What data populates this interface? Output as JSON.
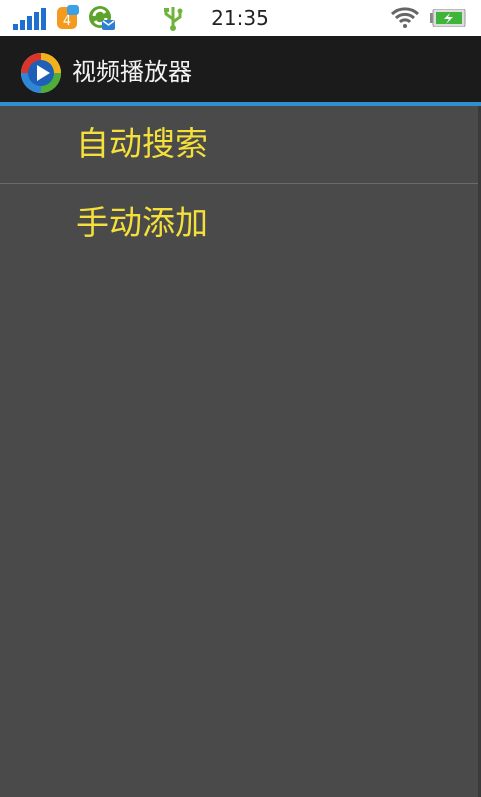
{
  "status_bar": {
    "time": "21:35",
    "badge_count": "4",
    "icons": [
      "signal-icon",
      "notification-badge-icon",
      "sync-mail-icon",
      "usb-icon",
      "wifi-icon",
      "battery-charging-icon"
    ]
  },
  "app_bar": {
    "title": "视频播放器",
    "icon": "video-player-icon"
  },
  "menu": {
    "items": [
      {
        "label": "自动搜索"
      },
      {
        "label": "手动添加"
      }
    ]
  },
  "colors": {
    "background": "#4a4a4a",
    "app_bar": "#1b1b1b",
    "accent": "#2f8fcf",
    "menu_text": "#f5df3a"
  }
}
